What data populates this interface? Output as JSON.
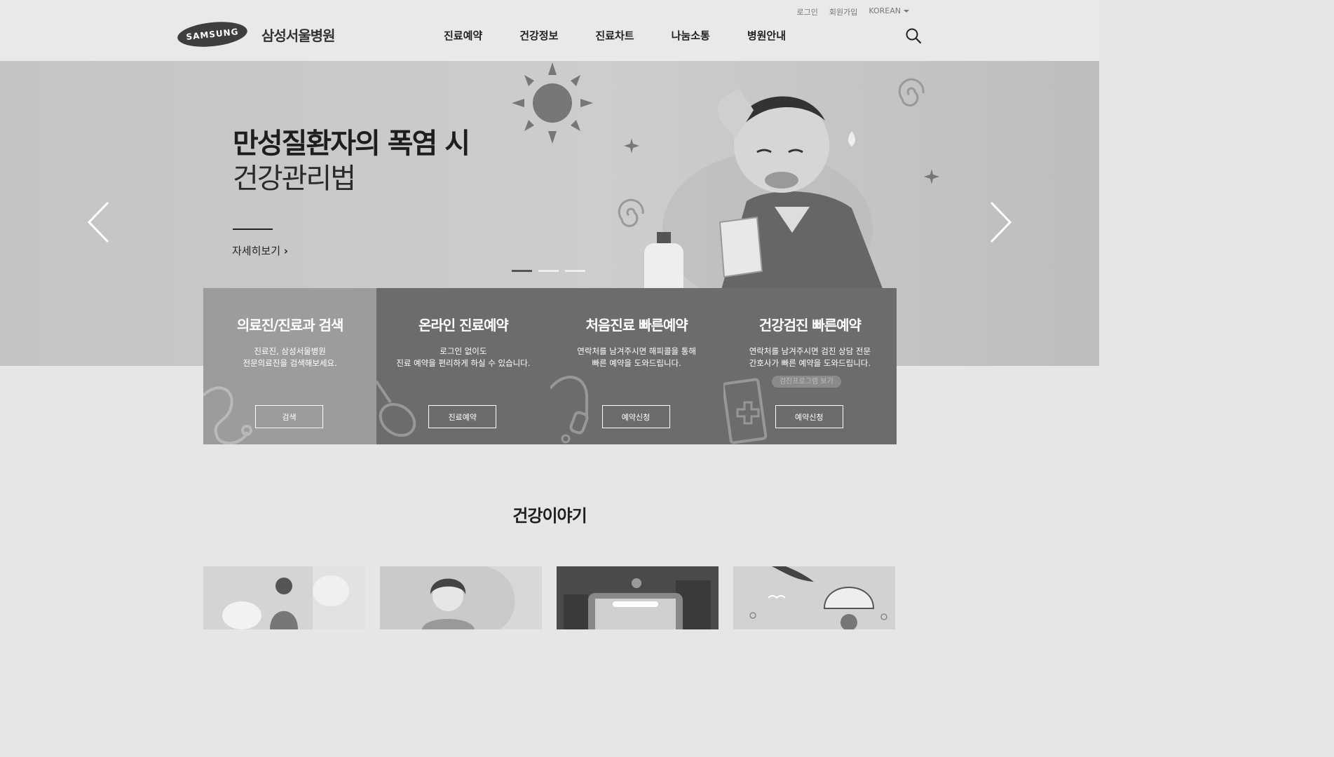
{
  "header": {
    "util_links": [
      "로그인",
      "회원가입"
    ],
    "language": "KOREAN",
    "logo_brand": "SAMSUNG",
    "logo_text": "삼성서울병원",
    "nav": [
      "진료예약",
      "건강정보",
      "진료차트",
      "나눔소통",
      "병원안내"
    ]
  },
  "hero": {
    "title_line1": "만성질환자의 폭염 시",
    "title_line2": "건강관리법",
    "more_label": "자세히보기",
    "slide_count": 3,
    "active_slide": 1
  },
  "cards": [
    {
      "title": "의료진/진료과 검색",
      "desc1": "진료진, 삼성서울병원",
      "desc2": "전문의료진을 검색해보세요.",
      "button": "검색",
      "icon": "stethoscope-icon"
    },
    {
      "title": "온라인 진료예약",
      "desc1": "로그인 없이도",
      "desc2": "진료 예약을 편리하게 하실 수 있습니다.",
      "button": "진료예약",
      "icon": "mouse-icon"
    },
    {
      "title": "처음진료 빠른예약",
      "desc1": "연락처를 남겨주시면 해피콜을 통해",
      "desc2": "빠른 예약을 도와드립니다.",
      "button": "예약신청",
      "icon": "headset-icon"
    },
    {
      "title": "건강검진 빠른예약",
      "desc1": "연락처를 남겨주시면 검진 상담 전문",
      "desc2": "간호사가 빠른 예약을 도와드립니다.",
      "badge": "검진프로그램 보기",
      "button": "예약신청",
      "icon": "medical-clipboard-icon"
    }
  ],
  "section": {
    "title": "건강이야기"
  },
  "colors": {
    "header_bg": "#e9e9e9",
    "hero_bg": "#c8c8c8",
    "card_primary": "#9c9c9c",
    "card_secondary": "#6c6c6c",
    "page_bg": "#e6e6e6"
  }
}
